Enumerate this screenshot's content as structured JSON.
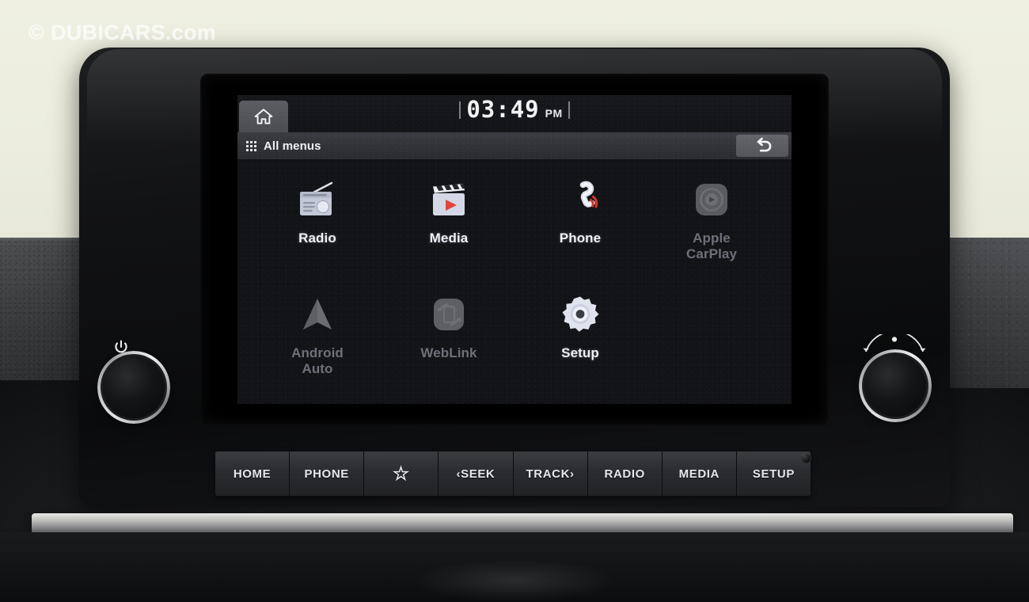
{
  "watermark": {
    "text": "© DUBICARS.com"
  },
  "head_unit": {
    "brand_context": "car-infotainment-head-unit"
  },
  "screen": {
    "status_bar": {
      "home_icon": "home-icon",
      "clock": {
        "time": "03:49",
        "ampm": "PM"
      }
    },
    "title_bar": {
      "grid_icon": "apps-grid-icon",
      "title": "All menus",
      "back_icon": "back-arrow-icon"
    },
    "menu": {
      "items": [
        {
          "label": "Radio",
          "icon": "radio-icon",
          "enabled": true
        },
        {
          "label": "Media",
          "icon": "media-clapper-icon",
          "enabled": true
        },
        {
          "label": "Phone",
          "icon": "phone-handset-icon",
          "enabled": true
        },
        {
          "label": "Apple\nCarPlay",
          "icon": "apple-carplay-icon",
          "enabled": false
        },
        {
          "label": "Android\nAuto",
          "icon": "android-auto-icon",
          "enabled": false
        },
        {
          "label": "WebLink",
          "icon": "weblink-icon",
          "enabled": false
        },
        {
          "label": "Setup",
          "icon": "setup-gear-icon",
          "enabled": true
        }
      ]
    }
  },
  "hardware": {
    "buttons": [
      {
        "label": "HOME",
        "name": "home"
      },
      {
        "label": "PHONE",
        "name": "phone"
      },
      {
        "label": "☆",
        "name": "favorite-star"
      },
      {
        "label": "‹SEEK",
        "name": "seek"
      },
      {
        "label": "TRACK›",
        "name": "track"
      },
      {
        "label": "RADIO",
        "name": "radio"
      },
      {
        "label": "MEDIA",
        "name": "media"
      },
      {
        "label": "SETUP",
        "name": "setup"
      }
    ],
    "left_knob": {
      "icon": "power-icon",
      "label": ""
    },
    "right_knob": {
      "icon": "tune-arc-icon",
      "label": ""
    },
    "sensor": "ir-sensor-hole"
  },
  "colors": {
    "screen_bg": "#121316",
    "title_bar": "#303237",
    "accent_red": "#e3453a",
    "icon_light": "#cfd5e4",
    "text_primary": "#f0f1f4",
    "text_dim": "#6d7078",
    "background": "#ecedde"
  }
}
